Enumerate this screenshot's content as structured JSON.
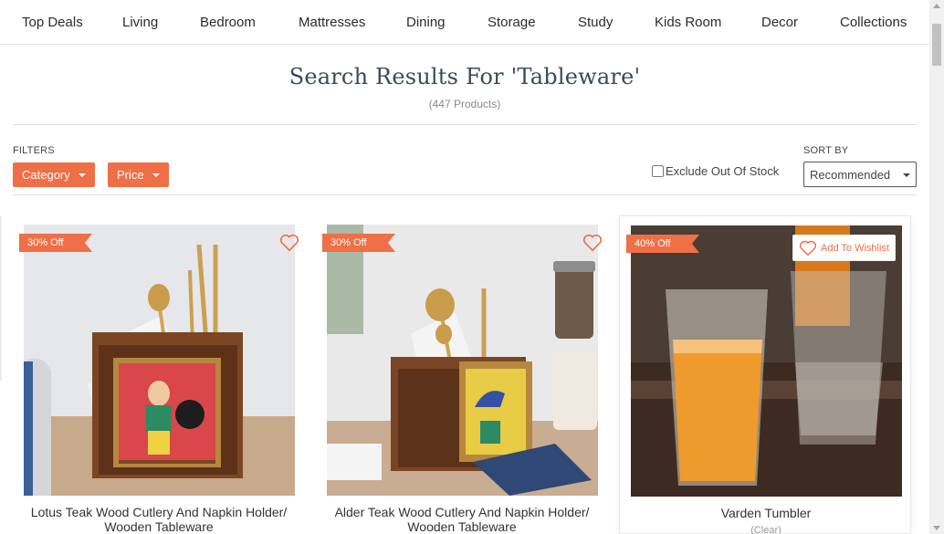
{
  "nav": [
    "Top Deals",
    "Living",
    "Bedroom",
    "Mattresses",
    "Dining",
    "Storage",
    "Study",
    "Kids Room",
    "Decor",
    "Collections"
  ],
  "search": {
    "title": "Search Results For 'Tableware'",
    "count": "(447 Products)"
  },
  "filters": {
    "label": "FILTERS",
    "category": "Category",
    "price": "Price",
    "exclude_label": "Exclude Out Of Stock",
    "exclude_checked": false,
    "sort_label": "SORT BY",
    "sort_value": "Recommended"
  },
  "colors": {
    "accent": "#ef6f47",
    "title": "#3b4a5a"
  },
  "products": [
    {
      "badge": "30% Off",
      "name": "Lotus Teak Wood Cutlery And Napkin Holder/ Wooden Tableware",
      "sub": "",
      "wishlist_label": "",
      "icon": "heart-icon"
    },
    {
      "badge": "30% Off",
      "name": "Alder Teak Wood Cutlery And Napkin Holder/ Wooden Tableware",
      "sub": "",
      "wishlist_label": "",
      "icon": "heart-icon"
    },
    {
      "badge": "40% Off",
      "name": "Varden Tumbler",
      "sub": "(Clear)",
      "wishlist_label": "Add To Wishlist",
      "icon": "heart-icon"
    }
  ]
}
